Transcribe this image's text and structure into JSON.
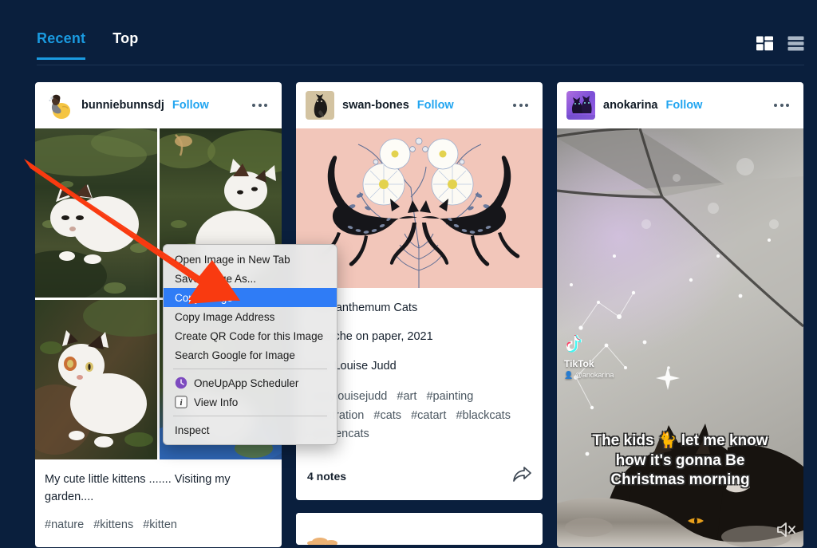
{
  "app": {
    "background_color": "#0a1f3d",
    "accent_color": "#1a9ae0"
  },
  "header": {
    "tabs": [
      {
        "label": "Recent",
        "active": true
      },
      {
        "label": "Top",
        "active": false
      }
    ],
    "view_toggles": [
      {
        "name": "grid-view-toggle",
        "label": "Grid view",
        "active": true
      },
      {
        "name": "list-view-toggle",
        "label": "List view",
        "active": false
      }
    ]
  },
  "posts": [
    {
      "username": "bunniebunnsdj",
      "follow_label": "Follow",
      "avatar_name": "avatar-bunniebunnsdj",
      "caption": "My cute little kittens ....... Visiting my garden....",
      "tags": [
        "#nature",
        "#kittens",
        "#kitten"
      ]
    },
    {
      "username": "swan-bones",
      "follow_label": "Follow",
      "avatar_name": "avatar-swan-bones",
      "title": "Chrysanthemum Cats",
      "medium": "Gouache on paper, 2021",
      "artist": "Kelly Louise Judd",
      "tags": [
        "#kellylouisejudd",
        "#art",
        "#painting",
        "#illustration",
        "#cats",
        "#catart",
        "#blackcats",
        "#gardencats"
      ],
      "notes": "4 notes",
      "share_label": "Share"
    },
    {
      "username": "anokarina",
      "follow_label": "Follow",
      "avatar_name": "avatar-anokarina",
      "watermark_label": "TikTok",
      "watermark_handle": "@anokarina",
      "video_caption_lines": [
        "The kids 🐈 let me know",
        "how it's gonna Be",
        "Christmas morning"
      ],
      "mute_label": "Muted"
    }
  ],
  "context_menu": {
    "items": [
      {
        "label": "Open Image in New Tab",
        "selected": false,
        "icon": null
      },
      {
        "label": "Save Image As...",
        "selected": false,
        "icon": null
      },
      {
        "label": "Copy Image",
        "selected": true,
        "icon": null
      },
      {
        "label": "Copy Image Address",
        "selected": false,
        "icon": null
      },
      {
        "label": "Create QR Code for this Image",
        "selected": false,
        "icon": null
      },
      {
        "label": "Search Google for Image",
        "selected": false,
        "icon": null
      },
      {
        "separator": true
      },
      {
        "label": "OneUpApp Scheduler",
        "selected": false,
        "icon": "oneup-icon"
      },
      {
        "label": "View Info",
        "selected": false,
        "icon": "info-icon"
      },
      {
        "separator": true
      },
      {
        "label": "Inspect",
        "selected": false,
        "icon": null
      }
    ],
    "highlight_color": "#2f7cf6"
  },
  "annotation": {
    "arrow_color": "#f93a10",
    "points_to": "Copy Image"
  }
}
